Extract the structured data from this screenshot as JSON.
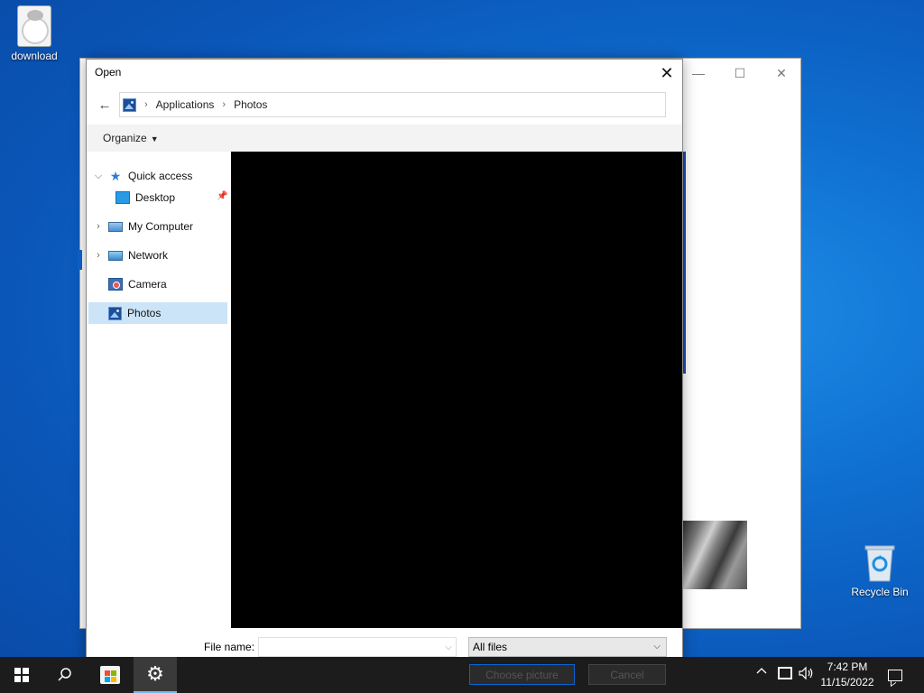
{
  "desktop": {
    "icons": [
      {
        "label": "download"
      },
      {
        "label": "Recycle Bin"
      }
    ]
  },
  "background_window": {
    "controls": {
      "minimize": "—",
      "maximize": "☐",
      "close": "✕"
    }
  },
  "dialog": {
    "title": "Open",
    "close_glyph": "✕",
    "back_glyph": "←",
    "breadcrumb": [
      "Applications",
      "Photos"
    ],
    "breadcrumb_sep": "›",
    "toolbar": {
      "organize_label": "Organize"
    },
    "nav": [
      {
        "label": "Quick access",
        "icon": "star-icon",
        "expanded": true
      },
      {
        "label": "Desktop",
        "icon": "desktop-icon",
        "pinned": true
      },
      {
        "label": "My Computer",
        "icon": "computer-icon",
        "expanded": false
      },
      {
        "label": "Network",
        "icon": "network-icon",
        "expanded": false
      },
      {
        "label": "Camera",
        "icon": "camera-icon"
      },
      {
        "label": "Photos",
        "icon": "photos-icon",
        "selected": true
      }
    ],
    "file_name_label": "File name:",
    "file_name_value": "",
    "file_type_value": "All files",
    "choose_button": "Choose picture",
    "cancel_button": "Cancel"
  },
  "taskbar": {
    "search_glyph": "⚲",
    "settings_glyph": "⚙",
    "tray_chevron": "︿",
    "volume_glyph": "🕪",
    "time": "7:42 PM",
    "date": "11/15/2022"
  },
  "colors": {
    "accent": "#0a64d2",
    "selection": "#cce4f7",
    "taskbar": "#1c1c1c"
  }
}
